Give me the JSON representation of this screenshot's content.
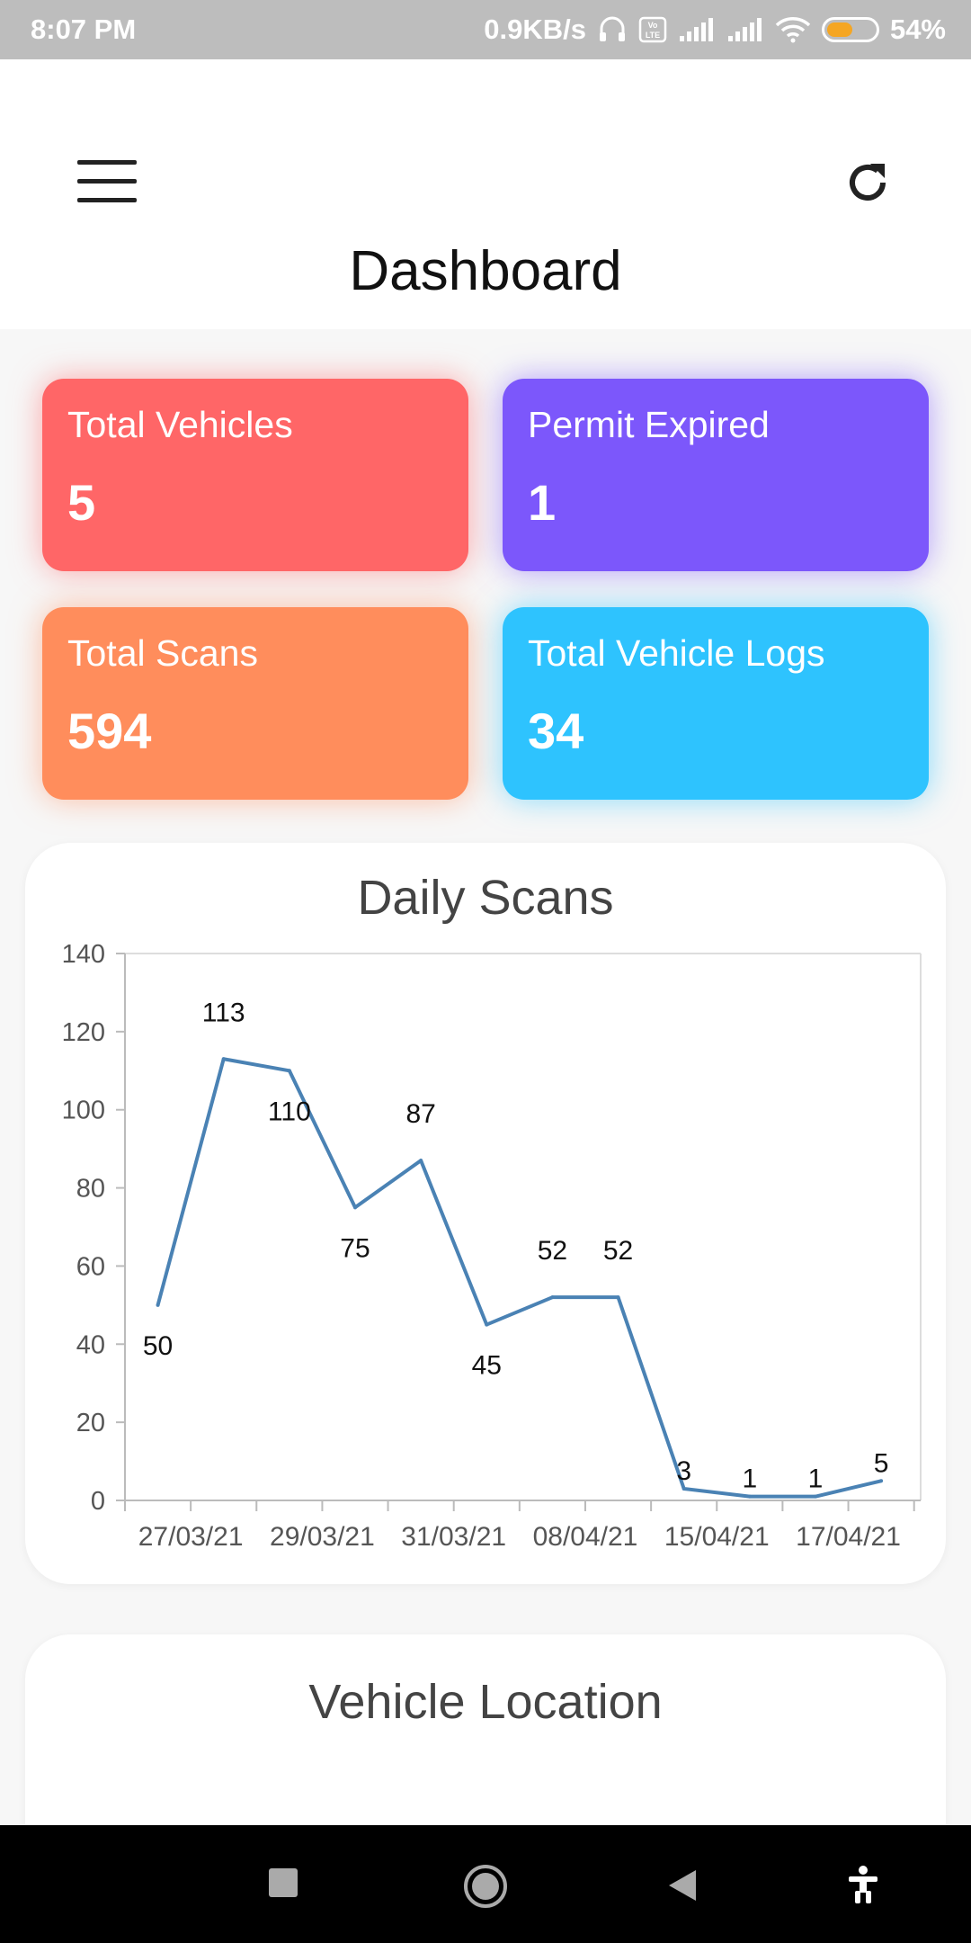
{
  "status_bar": {
    "time": "8:07 PM",
    "network_speed": "0.9KB/s",
    "battery_percent": "54%",
    "battery_level": 0.54,
    "icons": [
      "headset-icon",
      "volte-icon",
      "signal-icon",
      "signal-icon",
      "wifi-icon",
      "battery-icon"
    ]
  },
  "header": {
    "title": "Dashboard",
    "menu_icon": "hamburger-menu-icon",
    "refresh_icon": "refresh-icon"
  },
  "stats": [
    {
      "label": "Total Vehicles",
      "value": "5",
      "color": "#ff6667"
    },
    {
      "label": "Permit Expired",
      "value": "1",
      "color": "#7c57fb"
    },
    {
      "label": "Total Scans",
      "value": "594",
      "color": "#ff8d5c"
    },
    {
      "label": "Total Vehicle Logs",
      "value": "34",
      "color": "#2ec3fe"
    }
  ],
  "chart_data": {
    "type": "line",
    "title": "Daily Scans",
    "xlabel": "",
    "ylabel": "",
    "ylim": [
      0,
      140
    ],
    "yticks": [
      0,
      20,
      40,
      60,
      80,
      100,
      120,
      140
    ],
    "x_tick_labels": [
      "27/03/21",
      "29/03/21",
      "31/03/21",
      "08/04/21",
      "15/04/21",
      "17/04/21"
    ],
    "values": [
      50,
      113,
      110,
      75,
      87,
      45,
      52,
      52,
      3,
      1,
      1,
      5
    ],
    "data_labels": [
      "50",
      "113",
      "110",
      "75",
      "87",
      "45",
      "52",
      "52",
      "3",
      "1",
      "1",
      "5"
    ],
    "line_color": "#4a82b4",
    "grid": false,
    "legend": "none"
  },
  "location": {
    "title": "Vehicle Location"
  },
  "nav_bar": {
    "icons": [
      "recent-apps-icon",
      "home-icon",
      "back-icon",
      "accessibility-icon"
    ]
  }
}
